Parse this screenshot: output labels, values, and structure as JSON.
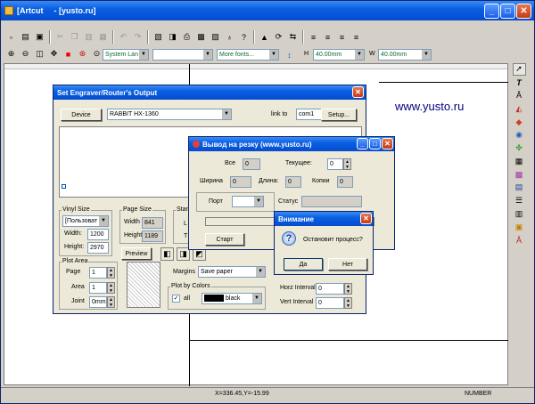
{
  "app": {
    "title": "[Artcut - [yusto.ru]",
    "title_left": "[Artcut",
    "title_right": "- [yusto.ru]"
  },
  "toolbar2": {
    "font_select": "System Lan",
    "font_style": "",
    "more_fonts": "More fonts...",
    "h_label": "H",
    "h_value": "40.00mm",
    "w_label": "W",
    "w_value": "40.00mm"
  },
  "canvas": {
    "watermark": "www.yusto.ru"
  },
  "status_bar": {
    "coords": "X=336.45,Y=-15.99",
    "mode": "NUMBER"
  },
  "engraver_dialog": {
    "title": "Set Engraver/Router's Output",
    "device_button": "Device",
    "device_value": "RABBIT HX-1360",
    "link_to_label": "link to",
    "port_value": "com1",
    "setup_button": "Setup...",
    "vinyl_size_label": "Vinyl Size",
    "vinyl_select": "[Пользоват",
    "width_label": "Width:",
    "width_value": "1200",
    "height_label": "Height:",
    "height_value": "2970",
    "page_size_label": "Page Size",
    "page_width_label": "Width",
    "page_width_value": "841",
    "page_height_label": "Height",
    "page_height_value": "1189",
    "start_label": "Start",
    "start_l_label": "L",
    "start_t_label": "T",
    "preview_button": "Preview",
    "plot_area_label": "Plot Area",
    "page_label": "Page",
    "page_value": "1",
    "area_label": "Area",
    "area_value": "1",
    "joint_label": "Joint",
    "joint_value": "0mm",
    "margins_label": "Margins",
    "margins_value": "Save paper",
    "plot_by_colors_label": "Plot by Colors",
    "all_label": "all",
    "color_value": "black",
    "horz_interval_label": "Horz Interval",
    "horz_interval_value": "0",
    "vert_interval_label": "Vert Interval",
    "vert_interval_value": "0"
  },
  "cut_dialog": {
    "title": "Вывод на резку (www.yusto.ru)",
    "all_label": "Все",
    "all_value": "0",
    "current_label": "Текущее:",
    "current_value": "0",
    "width_label": "Ширина",
    "width_value": "0",
    "length_label": "Длина:",
    "length_value": "0",
    "copies_label": "Копии",
    "copies_value": "0",
    "port_label": "Порт",
    "status_label": "Статус",
    "start_button": "Старт"
  },
  "alert_dialog": {
    "title": "Внимание",
    "message": "Остановит процесс?",
    "yes_button": "Да",
    "no_button": "Нет"
  }
}
